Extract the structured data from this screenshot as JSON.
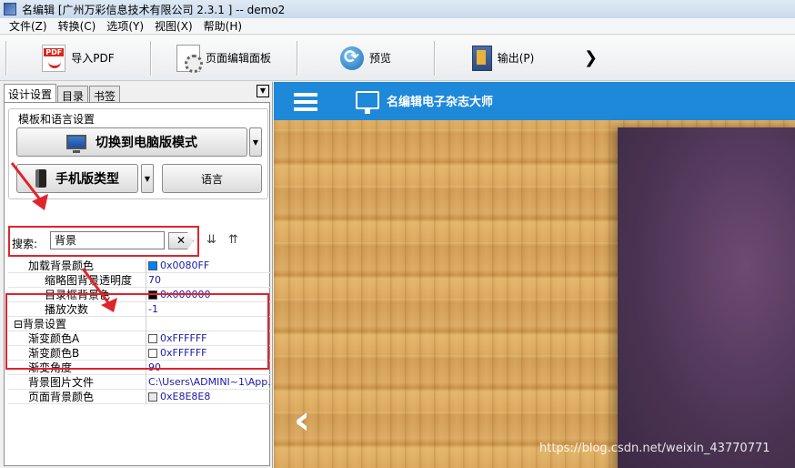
{
  "window": {
    "title": "名编辑 [广州万彩信息技术有限公司 2.3.1 ] -- demo2"
  },
  "menu": [
    "文件(Z)",
    "转换(C)",
    "选项(Y)",
    "视图(X)",
    "帮助(H)"
  ],
  "toolbar": {
    "import_pdf": "导入PDF",
    "page_editor": "页面编辑面板",
    "preview": "预览",
    "export": "输出(P)",
    "more_icon": "chevron-right-icon"
  },
  "tabs": [
    "设计设置",
    "目录",
    "书签"
  ],
  "template_group": {
    "title": "模板和语言设置",
    "switch_pc": "切换到电脑版模式",
    "mobile_type": "手机版类型",
    "language": "语言"
  },
  "search": {
    "label": "搜索:",
    "value": "背景",
    "clear": "✕"
  },
  "properties": [
    {
      "name": "加载背景颜色",
      "value": "0x0080FF",
      "color": "#0080FF",
      "indent": 1
    },
    {
      "name": "缩略图背景透明度",
      "value": "70",
      "indent": 2
    },
    {
      "name": "目录框背景色",
      "value": "0x000000",
      "color": "#000000",
      "indent": 2
    },
    {
      "name": "播放次数",
      "value": "-1",
      "indent": 2
    },
    {
      "name": "⊟背景设置",
      "value": "",
      "indent": 0,
      "category": true
    },
    {
      "name": "渐变颜色A",
      "value": "0xFFFFFF",
      "color": "#FFFFFF",
      "indent": 1
    },
    {
      "name": "渐变颜色B",
      "value": "0xFFFFFF",
      "color": "#FFFFFF",
      "indent": 1
    },
    {
      "name": "渐变角度",
      "value": "90",
      "indent": 1
    },
    {
      "name": "背景图片文件",
      "value": "C:\\Users\\ADMINI~1\\App...",
      "indent": 1
    },
    {
      "name": "页面背景颜色",
      "value": "0xE8E8E8",
      "color": "#E8E8E8",
      "indent": 1
    }
  ],
  "preview": {
    "brand": "名编辑电子杂志大师",
    "prev_arrow": "‹",
    "watermark": "https://blog.csdn.net/weixin_43770771"
  },
  "colors": {
    "header_blue": "#1E88D9",
    "highlight_red": "#E0242B"
  }
}
